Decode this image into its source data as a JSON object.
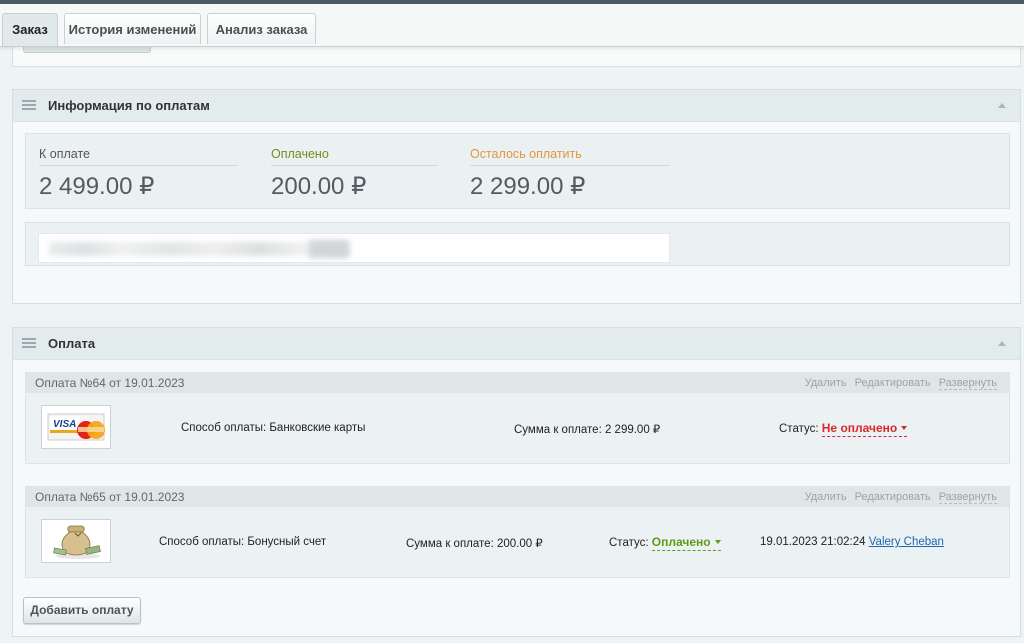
{
  "tabs": [
    {
      "label": "Заказ",
      "active": true
    },
    {
      "label": "История изменений",
      "active": false
    },
    {
      "label": "Анализ заказа",
      "active": false
    }
  ],
  "payment_info": {
    "title": "Информация по оплатам",
    "to_pay": {
      "label": "К оплате",
      "value": "2 499.00 ₽",
      "color": "#555555"
    },
    "paid": {
      "label": "Оплачено",
      "value": "200.00 ₽",
      "color": "#6d8f1e"
    },
    "remaining": {
      "label": "Осталось оплатить",
      "value": "2 299.00 ₽",
      "color": "#e3963d"
    }
  },
  "payments": {
    "title": "Оплата",
    "actions": {
      "delete": "Удалить",
      "edit": "Редактировать",
      "expand": "Развернуть"
    },
    "items": [
      {
        "title": "Оплата №64 от 19.01.2023",
        "icon": "visa-mastercard-icon",
        "method": "Способ оплаты: Банковские карты",
        "sum": "Сумма к оплате: 2 299.00 ₽",
        "status_label": "Статус:",
        "status": "Не оплачено",
        "status_color": "#d8282c"
      },
      {
        "title": "Оплата №65 от 19.01.2023",
        "icon": "money-bag-icon",
        "method": "Способ оплаты: Бонусный счет",
        "sum": "Сумма к оплате: 200.00 ₽",
        "status_label": "Статус:",
        "status": "Оплачено",
        "status_color": "#5f9a1b",
        "date": "19.01.2023 21:02:24",
        "user": "Valery Cheban"
      }
    ],
    "add_button": "Добавить оплату"
  }
}
